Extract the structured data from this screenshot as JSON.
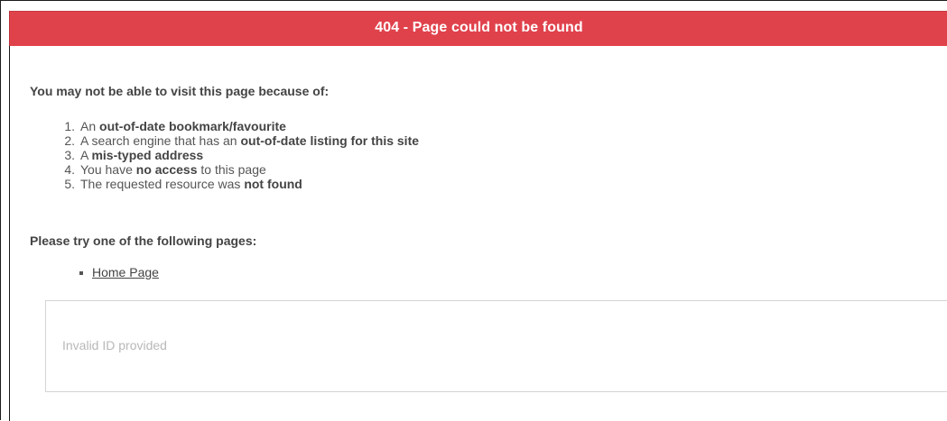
{
  "header": {
    "title": "404 - Page could not be found",
    "color": "#e0424c"
  },
  "intro_text": "You may not be able to visit this page because of:",
  "reasons": [
    {
      "number": "1.",
      "before": "An ",
      "bold": "out-of-date bookmark/favourite",
      "after": ""
    },
    {
      "number": "2.",
      "before": "A search engine that has an ",
      "bold": "out-of-date listing for this site",
      "after": ""
    },
    {
      "number": "3.",
      "before": "A ",
      "bold": "mis-typed address",
      "after": ""
    },
    {
      "number": "4.",
      "before": "You have ",
      "bold": "no access",
      "after": " to this page"
    },
    {
      "number": "5.",
      "before": "The requested resource was ",
      "bold": "not found",
      "after": ""
    }
  ],
  "try_heading": "Please try one of the following pages:",
  "pages": [
    {
      "label": "Home Page"
    }
  ],
  "message": "Invalid ID provided"
}
